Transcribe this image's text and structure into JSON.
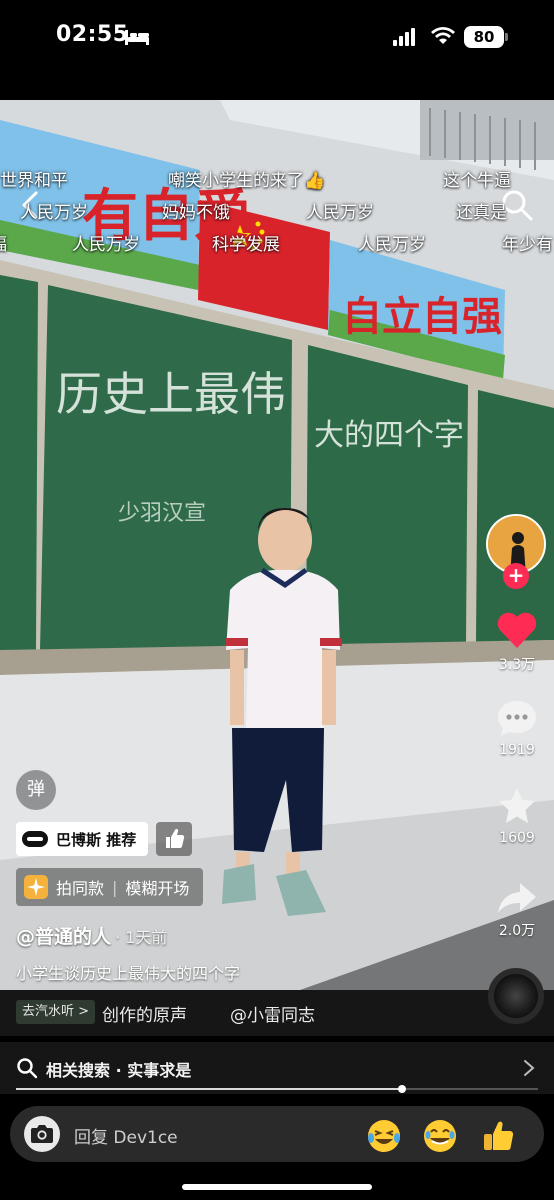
{
  "status_bar": {
    "time": "02:55",
    "battery": "80"
  },
  "danmaku": [
    {
      "text": "世界和平",
      "row": 1
    },
    {
      "text": "嘲笑小学生的来了👍",
      "row": 1
    },
    {
      "text": "这个牛逼",
      "row": 1
    },
    {
      "text": "人民万岁",
      "row": 2
    },
    {
      "text": "妈妈不饿",
      "row": 2
    },
    {
      "text": "人民万岁",
      "row": 2
    },
    {
      "text": "还真是",
      "row": 2
    },
    {
      "text": "福",
      "row": 3
    },
    {
      "text": "人民万岁",
      "row": 3
    },
    {
      "text": "科学发展",
      "row": 3
    },
    {
      "text": "人民万岁",
      "row": 3
    },
    {
      "text": "年少有",
      "row": 3
    }
  ],
  "scene": {
    "banner_left": "有自爱",
    "banner_right": "自立自强",
    "board_left": "历史上最伟",
    "board_right": "大的四个字",
    "board_small": "少羽汉宣"
  },
  "rail": {
    "likes": "3.3万",
    "comments": "1919",
    "favorites": "1609",
    "shares": "2.0万"
  },
  "left_info": {
    "danmu_toggle": "弹",
    "music_label": "巴博斯 推荐",
    "template_a": "拍同款",
    "template_sep": "|",
    "template_b": "模糊开场",
    "author": "@普通的人",
    "post_time": "· 1天前",
    "caption": "小学生谈历史上最伟大的四个字"
  },
  "sound": {
    "chip": "去汽水听 >",
    "text": "创作的原声",
    "user": "@小雷同志"
  },
  "related": {
    "text": "相关搜索 · 实事求是",
    "progress": 0.74
  },
  "reply": {
    "placeholder": "回复 Dev1ce"
  },
  "colors": {
    "accent": "#fe2c55",
    "board": "#2f6b4a",
    "bg": "#000000"
  }
}
